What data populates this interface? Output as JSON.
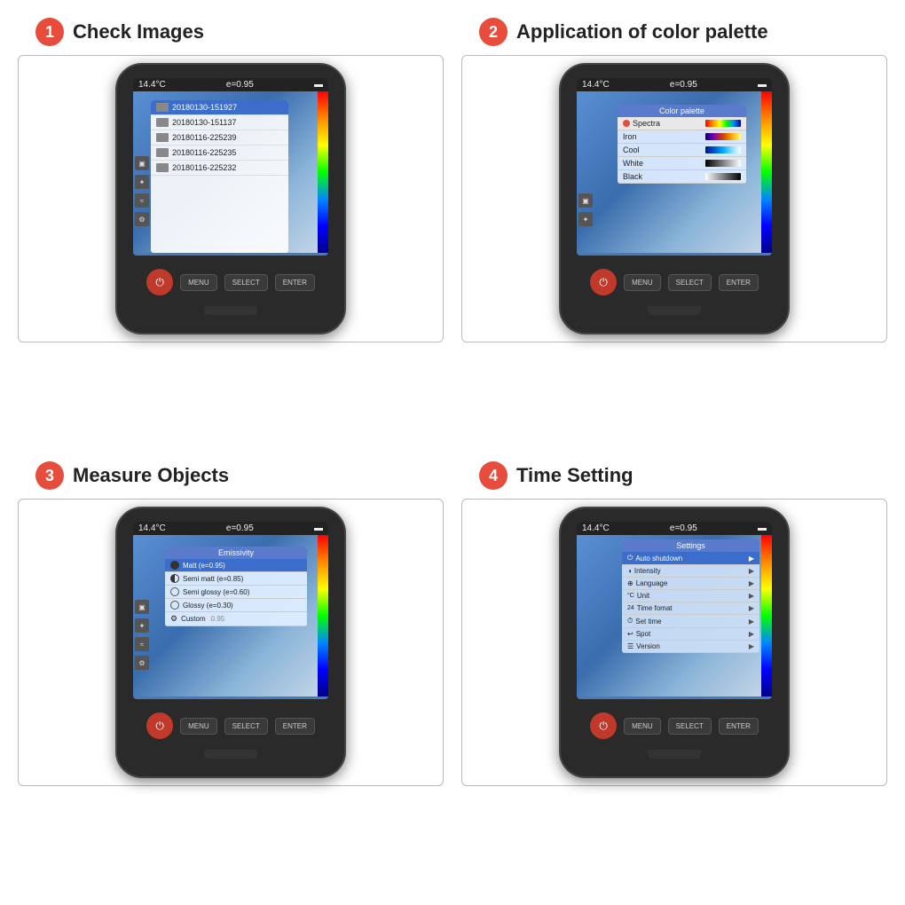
{
  "sections": [
    {
      "number": "1",
      "title": "Check Images",
      "temp": "14.4°C",
      "emissivity": "e=0.95",
      "files": [
        "20180130-151927",
        "20180130-151137",
        "20180116-225239",
        "20180116-225235",
        "20180116-225232"
      ]
    },
    {
      "number": "2",
      "title": "Application of color palette",
      "temp": "14.4°C",
      "emissivity": "e=0.95",
      "palette_title": "Color palette",
      "palettes": [
        {
          "name": "Spectra",
          "selected": true
        },
        {
          "name": "Iron",
          "selected": false
        },
        {
          "name": "Cool",
          "selected": false
        },
        {
          "name": "White",
          "selected": false
        },
        {
          "name": "Black",
          "selected": false
        }
      ]
    },
    {
      "number": "3",
      "title": "Measure Objects",
      "temp": "14.4°C",
      "emissivity": "e=0.95",
      "emissivity_title": "Emissivity",
      "emissivity_items": [
        {
          "name": "Matt (e=0.95)",
          "selected": true,
          "type": "filled"
        },
        {
          "name": "Semi matt (e=0.85)",
          "selected": false,
          "type": "half"
        },
        {
          "name": "Semi glossy (e=0.60)",
          "selected": false,
          "type": "ring"
        },
        {
          "name": "Glossy (e=0.30)",
          "selected": false,
          "type": "empty"
        },
        {
          "name": "Custom",
          "value": "0.95",
          "selected": false,
          "type": "gear"
        }
      ]
    },
    {
      "number": "4",
      "title": "Time Setting",
      "temp": "14.4°C",
      "emissivity": "e=0.95",
      "settings_title": "Settings",
      "settings_items": [
        {
          "name": "Auto shutdown",
          "selected": true,
          "icon": "⏻"
        },
        {
          "name": "Intensity",
          "selected": false,
          "icon": "◑"
        },
        {
          "name": "Language",
          "selected": false,
          "icon": "🌐"
        },
        {
          "name": "Unit",
          "selected": false,
          "icon": "°C"
        },
        {
          "name": "Time fomat",
          "selected": false,
          "icon": "24"
        },
        {
          "name": "Set time",
          "selected": false,
          "icon": "⏱"
        },
        {
          "name": "Spot",
          "selected": false,
          "icon": "↩"
        },
        {
          "name": "Version",
          "selected": false,
          "icon": "☰"
        }
      ]
    }
  ],
  "buttons": {
    "menu": "MENU",
    "select": "SELECT",
    "enter": "ENTER"
  }
}
